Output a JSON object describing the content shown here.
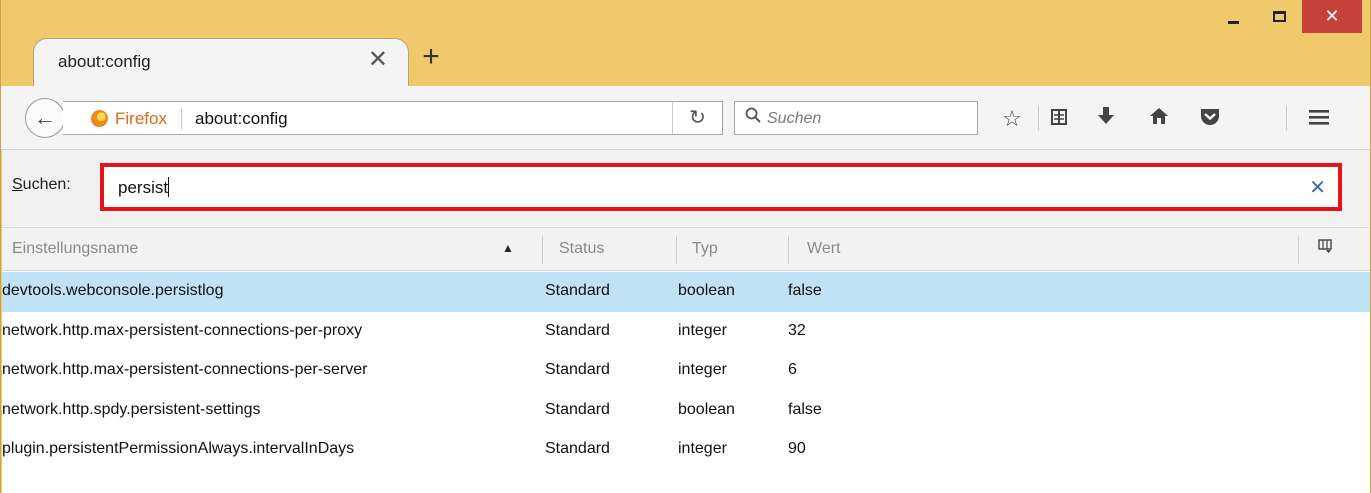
{
  "window": {
    "minimize_glyph": "–",
    "maximize_glyph": "□",
    "close_glyph": "✕"
  },
  "tab": {
    "title": "about:config",
    "close_glyph": "✕",
    "new_tab_glyph": "+"
  },
  "navbar": {
    "back_glyph": "←",
    "identity_label": "Firefox",
    "url": "about:config",
    "reload_glyph": "↻",
    "search_placeholder": "Suchen",
    "icons": [
      "star-icon",
      "reading-list-icon",
      "download-icon",
      "home-icon",
      "pocket-icon",
      "menu-icon"
    ]
  },
  "filter": {
    "label_access_key": "S",
    "label_rest": "uchen:",
    "value": "persist",
    "clear_glyph": "✕"
  },
  "grid": {
    "columns": [
      "Einstellungsname",
      "Status",
      "Typ",
      "Wert"
    ],
    "sort_indicator": "▲",
    "rows": [
      {
        "name": "devtools.webconsole.persistlog",
        "status": "Standard",
        "type": "boolean",
        "value": "false",
        "selected": true
      },
      {
        "name": "network.http.max-persistent-connections-per-proxy",
        "status": "Standard",
        "type": "integer",
        "value": "32",
        "selected": false
      },
      {
        "name": "network.http.max-persistent-connections-per-server",
        "status": "Standard",
        "type": "integer",
        "value": "6",
        "selected": false
      },
      {
        "name": "network.http.spdy.persistent-settings",
        "status": "Standard",
        "type": "boolean",
        "value": "false",
        "selected": false
      },
      {
        "name": "plugin.persistentPermissionAlways.intervalInDays",
        "status": "Standard",
        "type": "integer",
        "value": "90",
        "selected": false
      }
    ]
  },
  "colors": {
    "titlebar": "#f0c96b",
    "close_button": "#c7413b",
    "highlight_border": "#e3141a",
    "selected_row": "#bfe2f5",
    "firefox_label": "#d86b16"
  }
}
